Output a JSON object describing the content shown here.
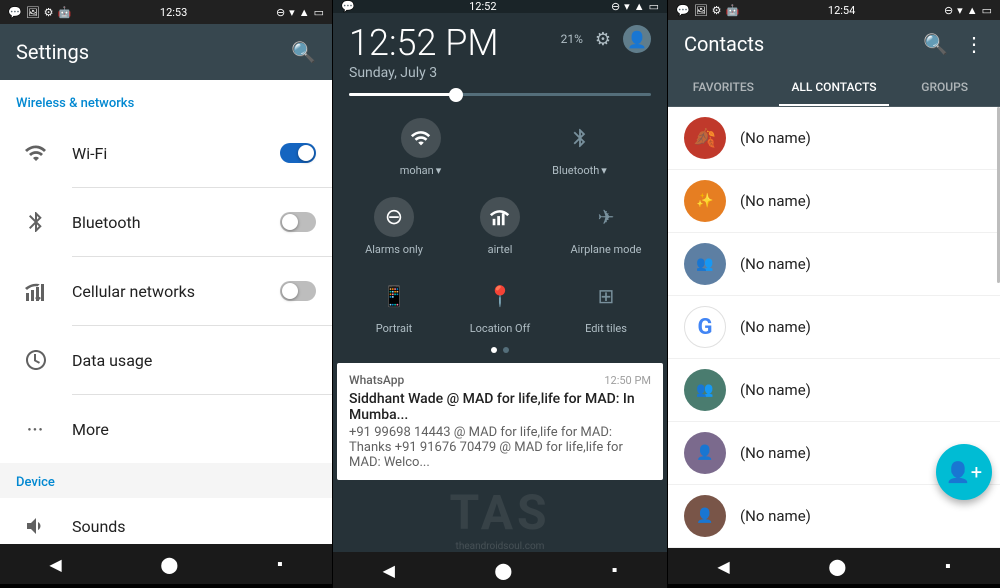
{
  "settings_panel": {
    "status_bar": {
      "time": "12:53"
    },
    "title": "Settings",
    "sections": {
      "wireless": {
        "header": "Wireless & networks",
        "items": [
          {
            "id": "wifi",
            "label": "Wi-Fi",
            "icon": "wifi",
            "toggle": true
          },
          {
            "id": "bluetooth",
            "label": "Bluetooth",
            "icon": "bluetooth",
            "toggle": false
          },
          {
            "id": "cellular",
            "label": "Cellular networks",
            "icon": "cellular",
            "toggle": false
          },
          {
            "id": "data",
            "label": "Data usage",
            "icon": "data",
            "toggle": null
          },
          {
            "id": "more",
            "label": "More",
            "icon": "more",
            "toggle": null
          }
        ]
      },
      "device": {
        "header": "Device",
        "items": [
          {
            "id": "sounds",
            "label": "Sounds",
            "icon": "sounds"
          }
        ]
      }
    }
  },
  "notification_panel": {
    "status_bar": {
      "time": "12:52"
    },
    "time": "12:52 PM",
    "date": "Sunday, July 3",
    "tiles": [
      {
        "id": "wifi",
        "label": "mohan",
        "has_arrow": true,
        "active": true
      },
      {
        "id": "bluetooth",
        "label": "Bluetooth",
        "has_arrow": true,
        "active": false
      },
      {
        "id": "dnd",
        "label": "Alarms only",
        "active": true
      },
      {
        "id": "signal",
        "label": "airtel",
        "active": true
      },
      {
        "id": "airplane",
        "label": "Airplane mode",
        "active": false
      },
      {
        "id": "portrait",
        "label": "Portrait",
        "active": false
      },
      {
        "id": "location",
        "label": "Location Off",
        "active": false
      },
      {
        "id": "edit",
        "label": "Edit tiles",
        "active": false
      }
    ],
    "notification": {
      "app": "WhatsApp",
      "time": "12:50 PM",
      "title": "Siddhant Wade @ MAD for life,life for MAD: In Mumba...",
      "body": "+91 99698 14443 @ MAD for life,life for MAD: Thanks\n+91 91676 70479 @ MAD for life,life for MAD: Welco..."
    },
    "watermark": "TAS",
    "watermark_sub": "theandroidsoul.com"
  },
  "contacts_panel": {
    "status_bar": {
      "time": "12:54"
    },
    "title": "Contacts",
    "tabs": [
      {
        "id": "favorites",
        "label": "FAVORITES",
        "active": false
      },
      {
        "id": "all",
        "label": "ALL CONTACTS",
        "active": true
      },
      {
        "id": "groups",
        "label": "GROUPS",
        "active": false
      }
    ],
    "contacts": [
      {
        "name": "(No name)",
        "avatar_color": "red",
        "emoji": "🍂"
      },
      {
        "name": "(No name)",
        "avatar_color": "orange",
        "emoji": "✨"
      },
      {
        "name": "(No name)",
        "avatar_color": "blue",
        "emoji": "👥"
      },
      {
        "name": "(No name)",
        "avatar_color": "google",
        "emoji": "G"
      },
      {
        "name": "(No name)",
        "avatar_color": "teal",
        "emoji": "👥"
      },
      {
        "name": "(No name)",
        "avatar_color": "purple",
        "emoji": "👤"
      },
      {
        "name": "(No name)",
        "avatar_color": "brown",
        "emoji": "👤"
      }
    ],
    "fab_icon": "+"
  }
}
